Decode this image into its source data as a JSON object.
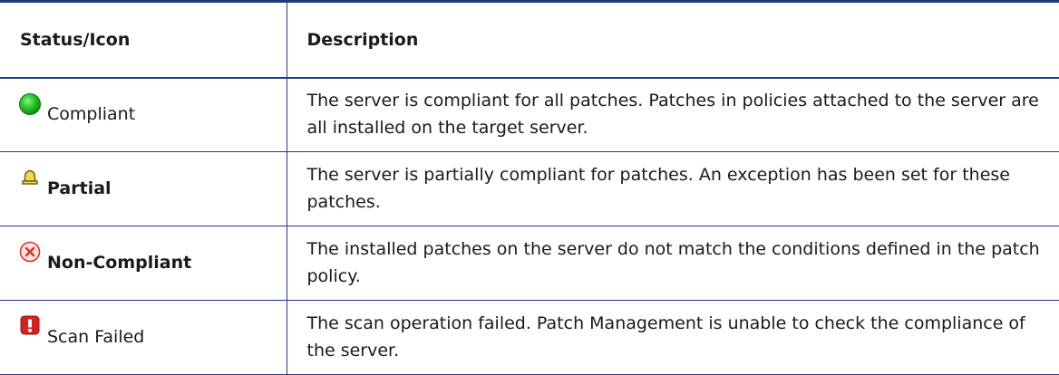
{
  "table": {
    "headers": {
      "status": "Status/Icon",
      "description": "Description"
    },
    "rows": [
      {
        "icon": "green-circle-icon",
        "status": "Compliant",
        "bold": false,
        "description": "The server is compliant for all patches. Patches in policies attached to the server are all installed on the target server."
      },
      {
        "icon": "yellow-bell-icon",
        "status": "Partial",
        "bold": true,
        "description": "The server is partially compliant for patches. An exception has been set for these patches."
      },
      {
        "icon": "red-x-circle-icon",
        "status": "Non-Compliant",
        "bold": true,
        "description": "The installed patches on the server do not match the conditions defined in the patch policy."
      },
      {
        "icon": "red-exclamation-icon",
        "status": "Scan Failed",
        "bold": false,
        "description": "The scan operation failed. Patch Management is unable to check the compliance of the server."
      }
    ]
  },
  "colors": {
    "border": "#1f3d7a",
    "compliant": "#22c322",
    "partial": "#f0d23a",
    "noncompliant": "#d9342b",
    "scanfailed": "#d8211a"
  }
}
